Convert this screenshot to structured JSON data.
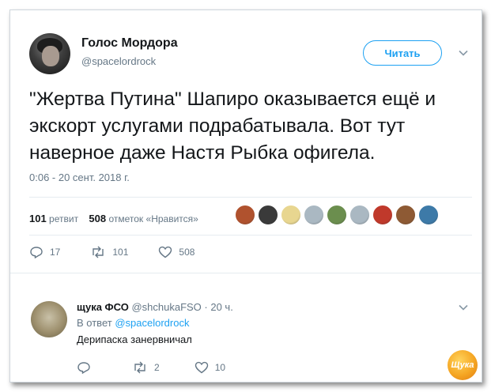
{
  "tweet": {
    "author_name": "Голос Мордора",
    "author_handle": "@spacelordrock",
    "follow_label": "Читать",
    "text": "\"Жертва Путина\" Шапиро оказывается ещё и экскорт услугами подрабатывала. Вот тут наверное даже Настя Рыбка офигела.",
    "timestamp": "0:06 - 20 сент. 2018 г.",
    "retweet_count": "101",
    "retweet_label": "ретвит",
    "like_count": "508",
    "like_label": "отметок «Нравится»",
    "actions": {
      "reply_count": "17",
      "retweet_count": "101",
      "like_count": "508"
    },
    "liker_colors": [
      "#b0522e",
      "#3a3a3a",
      "#e8d690",
      "#aab8c2",
      "#6b8e4e",
      "#aab8c2",
      "#c0392b",
      "#8e5a34",
      "#3d7aa8"
    ]
  },
  "reply": {
    "author_name": "щука ФСО",
    "author_handle": "@shchukaFSO",
    "time": "· 20 ч.",
    "reply_prefix": "В ответ",
    "reply_to": "@spacelordrock",
    "text": "Дерипаска занервничал",
    "actions": {
      "reply_count": "",
      "retweet_count": "2",
      "like_count": "10"
    }
  },
  "watermark": "Щука",
  "colors": {
    "accent": "#1da1f2",
    "muted": "#657786",
    "text": "#14171a"
  }
}
